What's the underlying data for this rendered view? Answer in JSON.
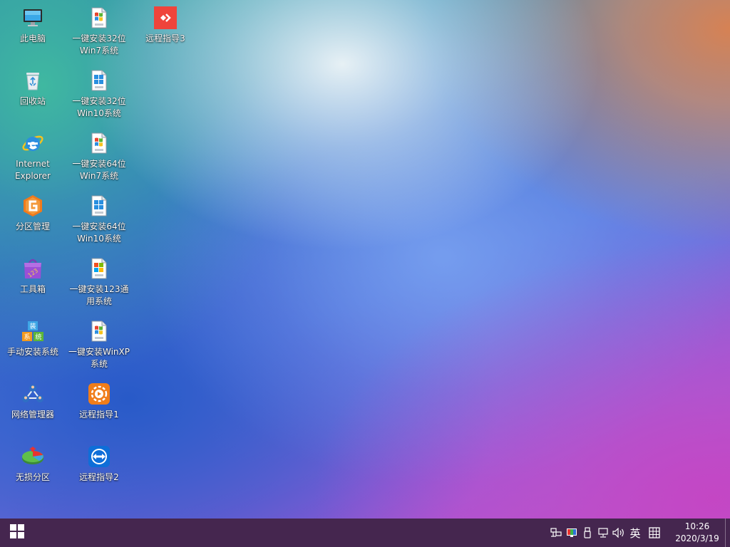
{
  "desktop": {
    "icons": [
      {
        "id": "this-pc",
        "lines": [
          "此电脑"
        ],
        "icon": "monitor-icon"
      },
      {
        "id": "recycle-bin",
        "lines": [
          "回收站"
        ],
        "icon": "recycle-bin-icon"
      },
      {
        "id": "internet-explorer",
        "lines": [
          "Internet",
          "Explorer"
        ],
        "icon": "internet-explorer-icon"
      },
      {
        "id": "partition-manager",
        "lines": [
          "分区管理"
        ],
        "icon": "diskgenius-icon"
      },
      {
        "id": "toolbox",
        "lines": [
          "工具箱"
        ],
        "icon": "toolbox-icon"
      },
      {
        "id": "manual-install",
        "lines": [
          "手动安装系统"
        ],
        "icon": "manual-install-icon"
      },
      {
        "id": "network-manager",
        "lines": [
          "网络管理器"
        ],
        "icon": "network-manager-icon"
      },
      {
        "id": "lossless-partition",
        "lines": [
          "无损分区"
        ],
        "icon": "partition-pie-icon"
      },
      {
        "id": "install-win7-32",
        "lines": [
          "一键安装32位",
          "Win7系统"
        ],
        "icon": "win7-installer-icon"
      },
      {
        "id": "install-win10-32",
        "lines": [
          "一键安装32位",
          "Win10系统"
        ],
        "icon": "win10-installer-icon"
      },
      {
        "id": "install-win7-64",
        "lines": [
          "一键安装64位",
          "Win7系统"
        ],
        "icon": "win7-installer-icon"
      },
      {
        "id": "install-win10-64",
        "lines": [
          "一键安装64位",
          "Win10系统"
        ],
        "icon": "win10-installer-icon"
      },
      {
        "id": "install-123-generic",
        "lines": [
          "一键安装123通",
          "用系统"
        ],
        "icon": "generic-installer-icon"
      },
      {
        "id": "install-winxp",
        "lines": [
          "一键安装WinXP",
          "系统"
        ],
        "icon": "winxp-installer-icon"
      },
      {
        "id": "remote-guide-1",
        "lines": [
          "远程指导1"
        ],
        "icon": "remote-guide-1-icon"
      },
      {
        "id": "remote-guide-2",
        "lines": [
          "远程指导2"
        ],
        "icon": "teamviewer-icon"
      },
      {
        "id": "remote-guide-3",
        "lines": [
          "远程指导3"
        ],
        "icon": "anydesk-icon"
      }
    ]
  },
  "taskbar": {
    "start_icon": "windows-logo-icon",
    "tray": {
      "icons": [
        "network-adapter-icon",
        "display-color-icon",
        "usb-device-icon",
        "network-icon",
        "volume-icon"
      ],
      "ime_label": "英",
      "ime_mode_icon": "ime-layout-icon"
    },
    "clock": {
      "time": "10:26",
      "date": "2020/3/19"
    }
  },
  "colors": {
    "taskbar_bg": "#45264f",
    "label_text": "#ffffff"
  }
}
